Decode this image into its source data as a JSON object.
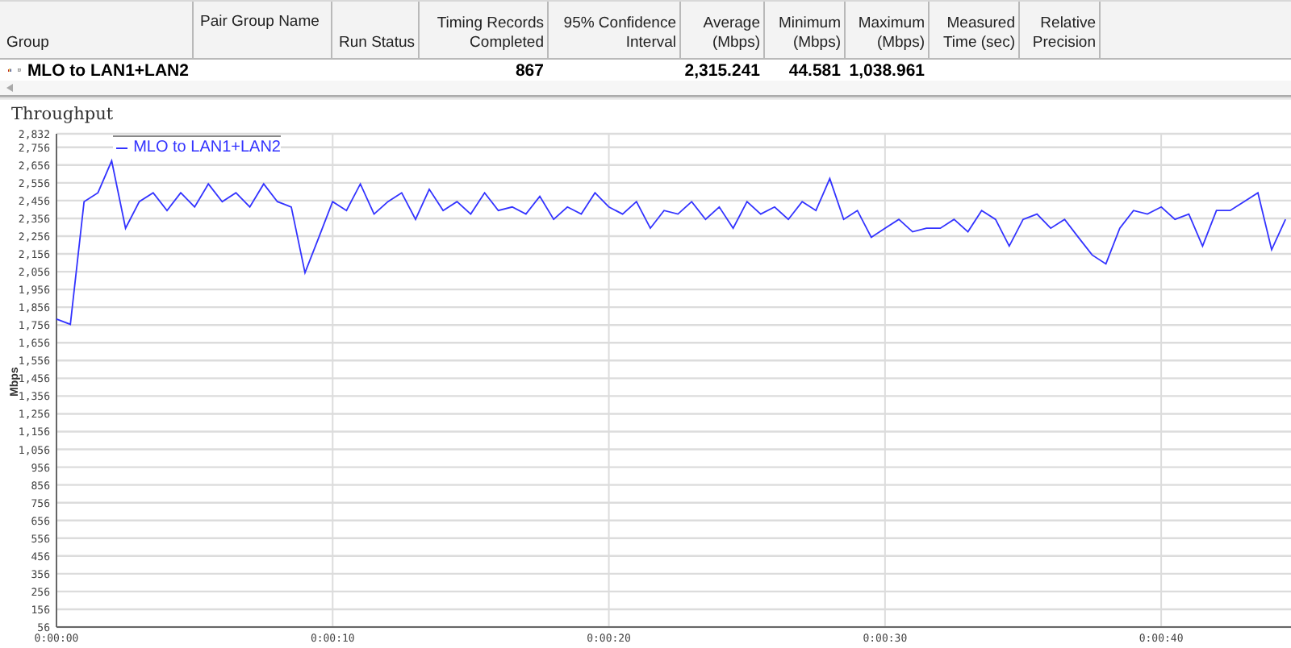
{
  "table": {
    "columns": [
      {
        "label": "Group"
      },
      {
        "label": "Pair Group Name"
      },
      {
        "label": "Run Status"
      },
      {
        "label": "Timing Records Completed"
      },
      {
        "label": "95% Confidence Interval"
      },
      {
        "label": "Average (Mbps)"
      },
      {
        "label": "Minimum (Mbps)"
      },
      {
        "label": "Maximum (Mbps)"
      },
      {
        "label": "Measured Time (sec)"
      },
      {
        "label": "Relative Precision"
      }
    ],
    "rows": [
      {
        "group": "MLO to LAN1+LAN2",
        "timing_records_completed": "867",
        "average": "2,315.241",
        "minimum": "44.581",
        "maximum": "1,038.961"
      }
    ]
  },
  "chart": {
    "title": "Throughput",
    "chart_data": {
      "type": "line",
      "grid": true,
      "ylabel": "Mbps",
      "xlim": [
        0,
        44.7
      ],
      "ylim": [
        56,
        2832
      ],
      "xticks": [
        {
          "value": 0,
          "label": "0:00:00"
        },
        {
          "value": 10,
          "label": "0:00:10"
        },
        {
          "value": 20,
          "label": "0:00:20"
        },
        {
          "value": 30,
          "label": "0:00:30"
        },
        {
          "value": 40,
          "label": "0:00:40"
        }
      ],
      "yticks": [
        56,
        156,
        256,
        356,
        456,
        556,
        656,
        756,
        856,
        956,
        {
          "value": 1056,
          "label": "1,056"
        },
        {
          "value": 1156,
          "label": "1,156"
        },
        {
          "value": 1256,
          "label": "1,256"
        },
        {
          "value": 1356,
          "label": "1,356"
        },
        {
          "value": 1456,
          "label": "1,456"
        },
        {
          "value": 1556,
          "label": "1,556"
        },
        {
          "value": 1656,
          "label": "1,656"
        },
        {
          "value": 1756,
          "label": "1,756"
        },
        {
          "value": 1856,
          "label": "1,856"
        },
        {
          "value": 1956,
          "label": "1,956"
        },
        {
          "value": 2056,
          "label": "2,056"
        },
        {
          "value": 2156,
          "label": "2,156"
        },
        {
          "value": 2256,
          "label": "2,256"
        },
        {
          "value": 2356,
          "label": "2,356"
        },
        {
          "value": 2456,
          "label": "2,456"
        },
        {
          "value": 2556,
          "label": "2,556"
        },
        {
          "value": 2656,
          "label": "2,656"
        },
        {
          "value": 2756,
          "label": "2,756"
        },
        {
          "value": 2832,
          "label": "2,832"
        }
      ],
      "x": [
        0,
        0.5,
        1,
        1.5,
        2,
        2.5,
        3,
        3.5,
        4,
        4.5,
        5,
        5.5,
        6,
        6.5,
        7,
        7.5,
        8,
        8.5,
        9,
        9.5,
        10,
        10.5,
        11,
        11.5,
        12,
        12.5,
        13,
        13.5,
        14,
        14.5,
        15,
        15.5,
        16,
        16.5,
        17,
        17.5,
        18,
        18.5,
        19,
        19.5,
        20,
        20.5,
        21,
        21.5,
        22,
        22.5,
        23,
        23.5,
        24,
        24.5,
        25,
        25.5,
        26,
        26.5,
        27,
        27.5,
        28,
        28.5,
        29,
        29.5,
        30,
        30.5,
        31,
        31.5,
        32,
        32.5,
        33,
        33.5,
        34,
        34.5,
        35,
        35.5,
        36,
        36.5,
        37,
        37.5,
        38,
        38.5,
        39,
        39.5,
        40,
        40.5,
        41,
        41.5,
        42,
        42.5,
        43,
        43.5,
        44,
        44.5
      ],
      "series": [
        {
          "name": "MLO to LAN1+LAN2",
          "color": "#3333ff",
          "values": [
            1790,
            1760,
            2450,
            2500,
            2680,
            2300,
            2450,
            2500,
            2400,
            2500,
            2420,
            2550,
            2450,
            2500,
            2420,
            2550,
            2450,
            2420,
            2050,
            2250,
            2450,
            2400,
            2550,
            2380,
            2450,
            2500,
            2350,
            2520,
            2400,
            2450,
            2380,
            2500,
            2400,
            2420,
            2380,
            2480,
            2350,
            2420,
            2380,
            2500,
            2420,
            2380,
            2450,
            2300,
            2400,
            2380,
            2450,
            2350,
            2420,
            2300,
            2450,
            2380,
            2420,
            2350,
            2450,
            2400,
            2580,
            2350,
            2400,
            2250,
            2300,
            2350,
            2280,
            2300,
            2300,
            2350,
            2280,
            2400,
            2350,
            2200,
            2350,
            2380,
            2300,
            2350,
            2250,
            2150,
            2100,
            2300,
            2400,
            2380,
            2420,
            2350,
            2380,
            2200,
            2400,
            2400,
            2450,
            2500,
            2180,
            2350
          ]
        }
      ]
    }
  }
}
